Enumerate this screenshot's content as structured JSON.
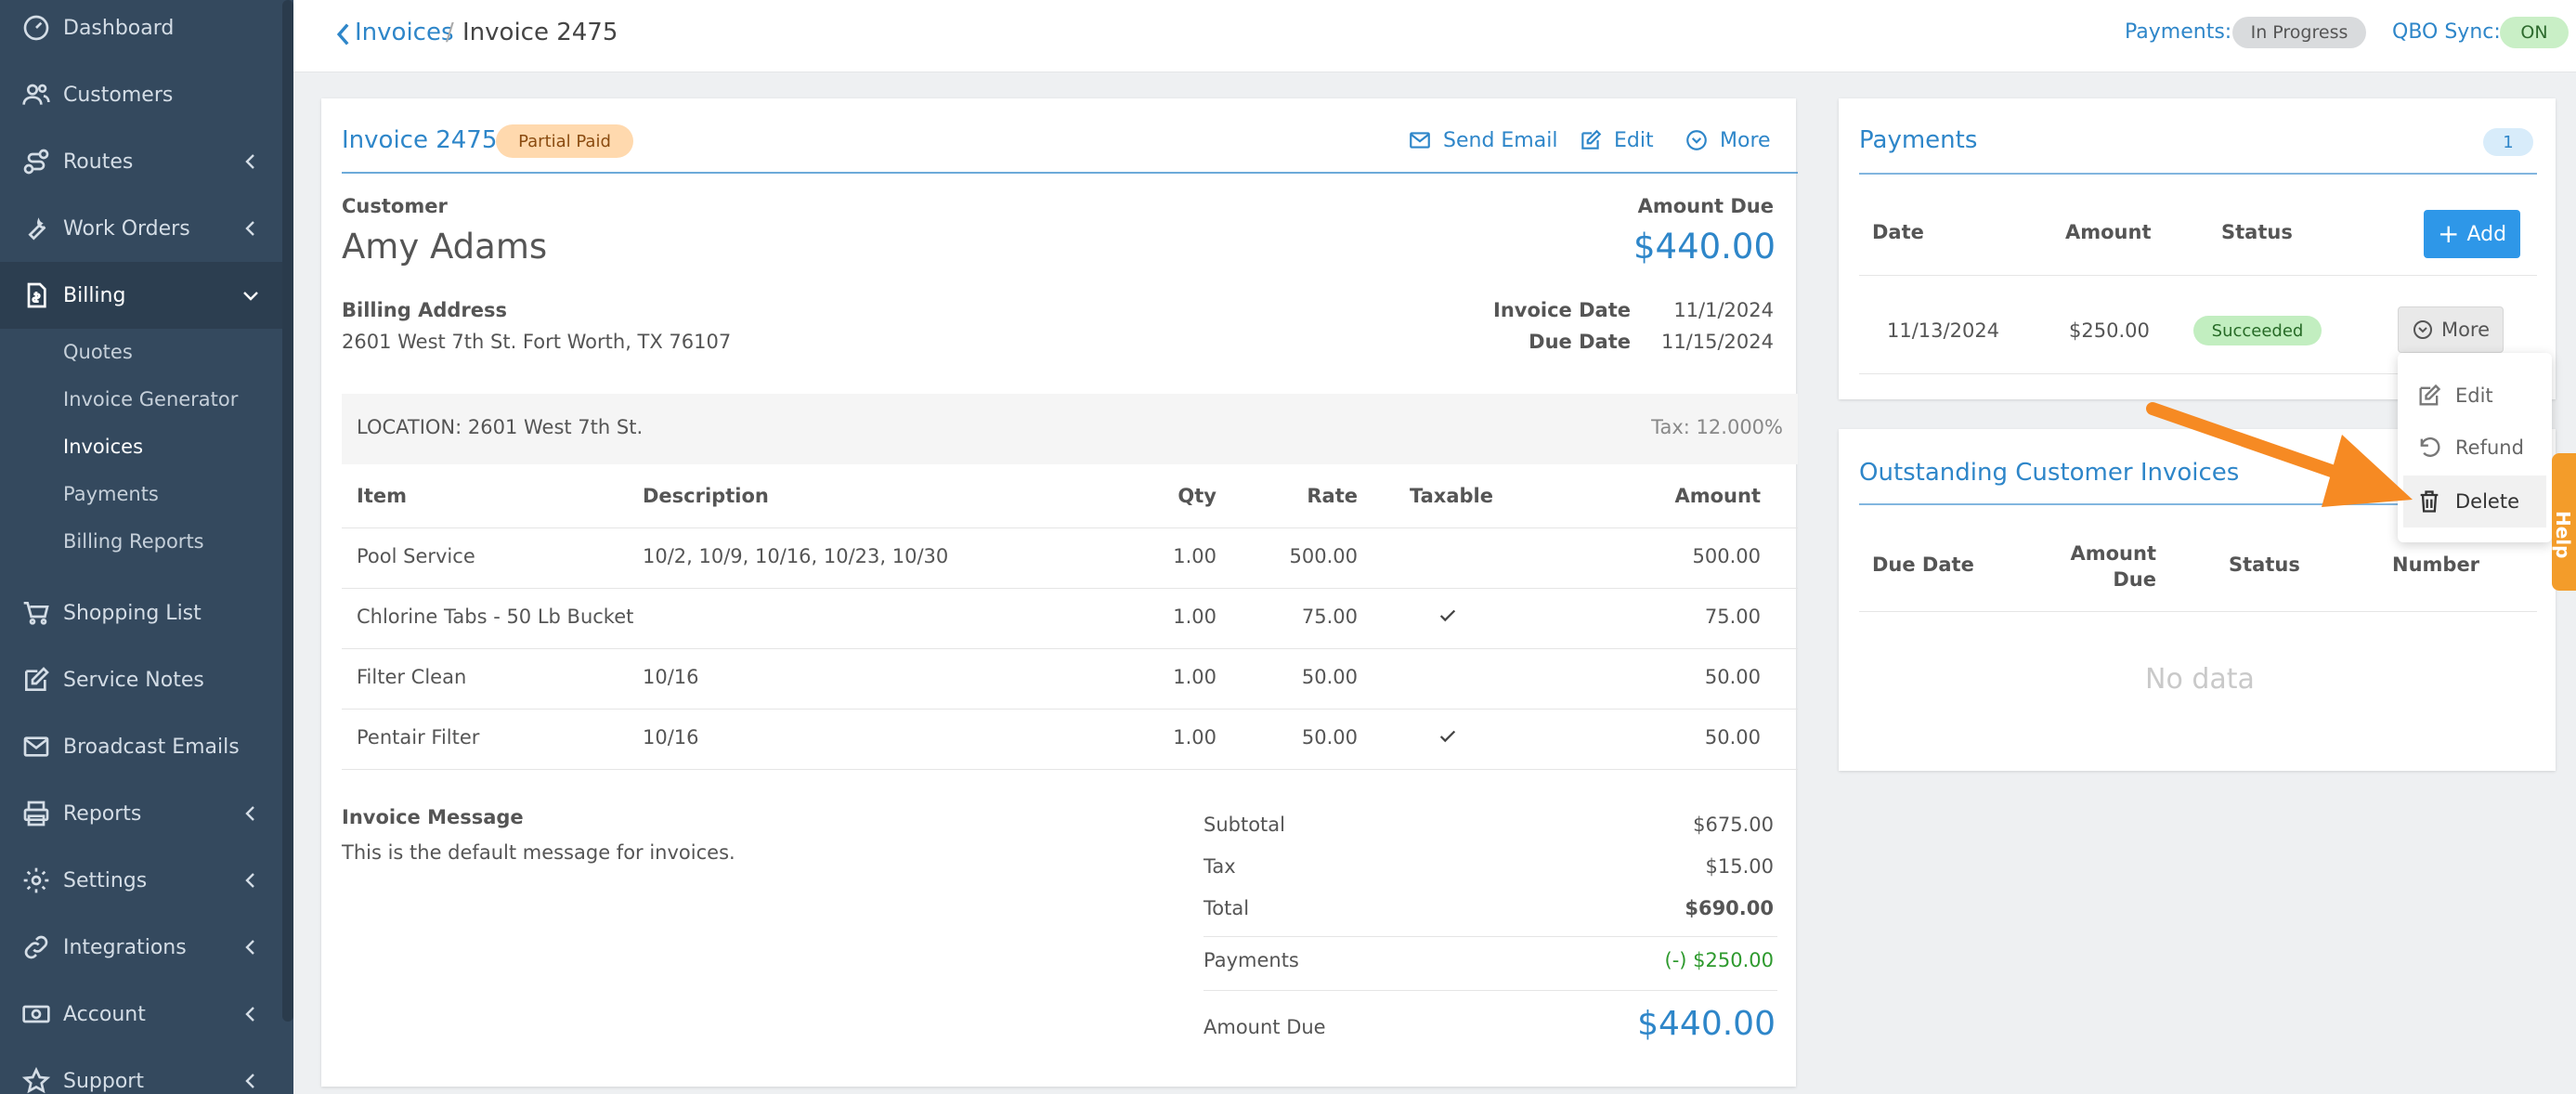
{
  "sidebar": {
    "items": [
      {
        "label": "Dashboard",
        "icon": "dashboard-icon"
      },
      {
        "label": "Customers",
        "icon": "customers-icon"
      },
      {
        "label": "Routes",
        "icon": "routes-icon"
      },
      {
        "label": "Work Orders",
        "icon": "wrench-icon"
      },
      {
        "label": "Billing",
        "icon": "billing-icon"
      },
      {
        "label": "Shopping List",
        "icon": "cart-icon"
      },
      {
        "label": "Service Notes",
        "icon": "edit-icon"
      },
      {
        "label": "Broadcast Emails",
        "icon": "mail-icon"
      },
      {
        "label": "Reports",
        "icon": "printer-icon"
      },
      {
        "label": "Settings",
        "icon": "gear-icon"
      },
      {
        "label": "Integrations",
        "icon": "link-icon"
      },
      {
        "label": "Account",
        "icon": "money-icon"
      },
      {
        "label": "Support",
        "icon": "star-icon"
      }
    ],
    "billing_sub": [
      "Quotes",
      "Invoice Generator",
      "Invoices",
      "Payments",
      "Billing Reports"
    ]
  },
  "topbar": {
    "crumb_parent": "Invoices",
    "crumb_sep": "/",
    "crumb_current": "Invoice 2475",
    "payments_label": "Payments:",
    "payments_status": "In Progress",
    "qbo_label": "QBO Sync:",
    "qbo_status": "ON"
  },
  "invoice": {
    "title": "Invoice 2475",
    "status": "Partial Paid",
    "actions": {
      "send_email": "Send Email",
      "edit": "Edit",
      "more": "More"
    },
    "customer_label": "Customer",
    "customer_name": "Amy Adams",
    "amount_due_label": "Amount Due",
    "amount_due": "$440.00",
    "billing_address_label": "Billing Address",
    "billing_address": "2601 West 7th St. Fort Worth, TX 76107",
    "invoice_date_label": "Invoice Date",
    "invoice_date": "11/1/2024",
    "due_date_label": "Due Date",
    "due_date": "11/15/2024",
    "location": "LOCATION: 2601 West 7th St.",
    "tax_rate": "Tax: 12.000%",
    "columns": [
      "Item",
      "Description",
      "Qty",
      "Rate",
      "Taxable",
      "Amount"
    ],
    "rows": [
      {
        "item": "Pool Service",
        "description": "10/2, 10/9, 10/16, 10/23, 10/30",
        "qty": "1.00",
        "rate": "500.00",
        "taxable": false,
        "amount": "500.00"
      },
      {
        "item": "Chlorine Tabs - 50 Lb Bucket",
        "description": "",
        "qty": "1.00",
        "rate": "75.00",
        "taxable": true,
        "amount": "75.00"
      },
      {
        "item": "Filter Clean",
        "description": "10/16",
        "qty": "1.00",
        "rate": "50.00",
        "taxable": false,
        "amount": "50.00"
      },
      {
        "item": "Pentair Filter",
        "description": "10/16",
        "qty": "1.00",
        "rate": "50.00",
        "taxable": true,
        "amount": "50.00"
      }
    ],
    "message_label": "Invoice Message",
    "message": "This is the default message for invoices.",
    "totals": {
      "subtotal_label": "Subtotal",
      "subtotal": "$675.00",
      "tax_label": "Tax",
      "tax": "$15.00",
      "total_label": "Total",
      "total": "$690.00",
      "payments_label": "Payments",
      "payments": "(-) $250.00",
      "amount_due_label": "Amount Due",
      "amount_due": "$440.00"
    }
  },
  "payments_card": {
    "title": "Payments",
    "count": "1",
    "columns": [
      "Date",
      "Amount",
      "Status"
    ],
    "add_label": "Add",
    "rows": [
      {
        "date": "11/13/2024",
        "amount": "$250.00",
        "status": "Succeeded",
        "more": "More"
      }
    ],
    "menu": [
      "Edit",
      "Refund",
      "Delete"
    ]
  },
  "outstanding_card": {
    "title": "Outstanding Customer Invoices",
    "columns": [
      "Due Date",
      "Amount\nDue",
      "Status",
      "Number"
    ],
    "col_amount_line1": "Amount",
    "col_amount_line2": "Due",
    "empty": "No data"
  },
  "help_label": "Help",
  "colors": {
    "accent": "#2e86c9",
    "sidebar": "#34495e",
    "arrow": "#f68a23"
  }
}
